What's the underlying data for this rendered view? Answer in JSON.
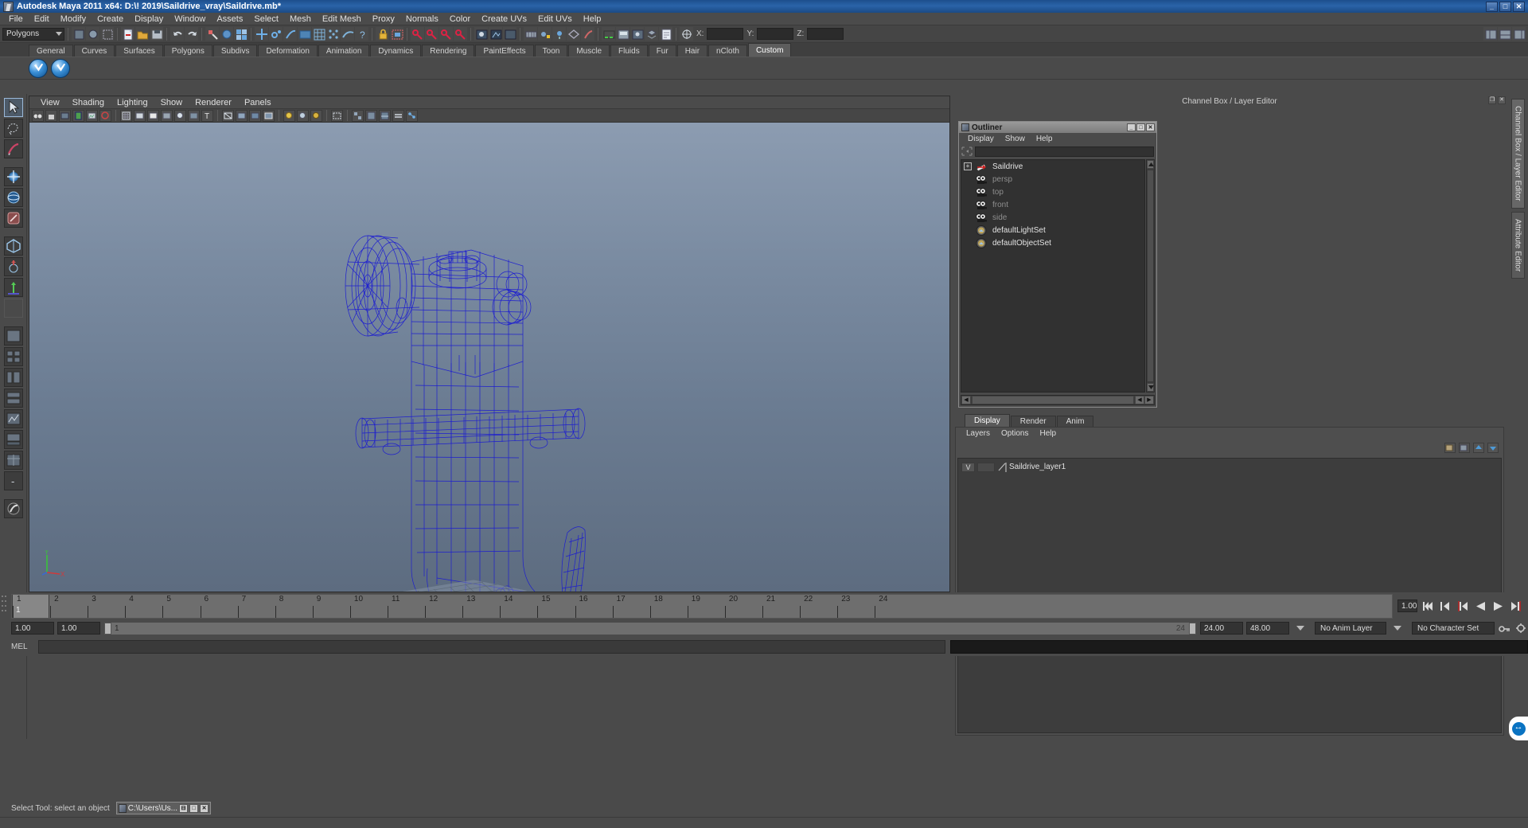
{
  "window": {
    "title": "Autodesk Maya 2011 x64: D:\\! 2019\\Saildrive_vray\\Saildrive.mb*",
    "minimize": "_",
    "maximize": "□",
    "close": "✕"
  },
  "menubar": {
    "items": [
      "File",
      "Edit",
      "Modify",
      "Create",
      "Display",
      "Window",
      "Assets",
      "Select",
      "Mesh",
      "Edit Mesh",
      "Proxy",
      "Normals",
      "Color",
      "Create UVs",
      "Edit UVs",
      "Help"
    ]
  },
  "statusline": {
    "selection_mode": "Polygons",
    "coord_labels": [
      "X:",
      "Y:",
      "Z:"
    ],
    "coord_values": [
      "",
      "",
      ""
    ]
  },
  "shelf": {
    "tabs": [
      "General",
      "Curves",
      "Surfaces",
      "Polygons",
      "Subdivs",
      "Deformation",
      "Animation",
      "Dynamics",
      "Rendering",
      "PaintEffects",
      "Toon",
      "Muscle",
      "Fluids",
      "Fur",
      "Hair",
      "nCloth",
      "Custom"
    ],
    "active_tab": "Custom",
    "buttons": [
      "vray-render-icon",
      "vray-rt-icon"
    ]
  },
  "viewport": {
    "menus": [
      "View",
      "Shading",
      "Lighting",
      "Show",
      "Renderer",
      "Panels"
    ],
    "axis_labels": {
      "y": "Y",
      "x": "X",
      "z": "Z"
    },
    "wireframe_color": "#1a1ad2",
    "background_top": "#8c9cb1",
    "background_bottom": "#5d6c80",
    "model_name": "Saildrive"
  },
  "rightdock": {
    "title": "Channel Box / Layer Editor"
  },
  "outliner": {
    "title": "Outliner",
    "titlebuttons": [
      "_",
      "□",
      "✕"
    ],
    "menus": [
      "Display",
      "Show",
      "Help"
    ],
    "search_value": "",
    "items": [
      {
        "label": "Saildrive",
        "icon": "transform-icon",
        "dim": false,
        "expandable": true
      },
      {
        "label": "persp",
        "icon": "camera-icon",
        "dim": true,
        "expandable": false
      },
      {
        "label": "top",
        "icon": "camera-icon",
        "dim": true,
        "expandable": false
      },
      {
        "label": "front",
        "icon": "camera-icon",
        "dim": true,
        "expandable": false
      },
      {
        "label": "side",
        "icon": "camera-icon",
        "dim": true,
        "expandable": false
      },
      {
        "label": "defaultLightSet",
        "icon": "set-icon",
        "dim": false,
        "expandable": false
      },
      {
        "label": "defaultObjectSet",
        "icon": "set-icon",
        "dim": false,
        "expandable": false
      }
    ]
  },
  "layer_editor": {
    "tabs": [
      "Display",
      "Render",
      "Anim"
    ],
    "active_tab": "Display",
    "menus": [
      "Layers",
      "Options",
      "Help"
    ],
    "layers": [
      {
        "visibility": "V",
        "playback": "",
        "name": "Saildrive_layer1"
      }
    ]
  },
  "vtabs": {
    "items": [
      "Channel Box / Layer Editor",
      "Attribute Editor"
    ],
    "active": "Channel Box / Layer Editor"
  },
  "timeslider": {
    "ticks": [
      1,
      2,
      3,
      4,
      5,
      6,
      7,
      8,
      9,
      10,
      11,
      12,
      13,
      14,
      15,
      16,
      17,
      18,
      19,
      20,
      21,
      22,
      23,
      24
    ],
    "current_frame": "1",
    "current_frame_field": "1.00",
    "playback_buttons": [
      "go-to-start-icon",
      "step-back-keyframe-icon",
      "step-back-frame-icon",
      "play-backwards-icon",
      "play-forwards-icon",
      "step-forward-frame-icon",
      "step-forward-keyframe-icon",
      "go-to-end-icon"
    ]
  },
  "rangeslider": {
    "anim_start": "1.00",
    "range_start": "1.00",
    "bar_start_label": "1",
    "bar_end_label": "24",
    "range_end": "24.00",
    "anim_end": "48.00",
    "anim_layer": "No Anim Layer",
    "character_set": "No Character Set"
  },
  "commandline": {
    "label": "MEL",
    "input_value": "",
    "output_value": ""
  },
  "helpline": {
    "text": "Select Tool: select an object",
    "taskbar_item": "C:\\Users\\Us...",
    "taskbar_buttons": [
      "⊟",
      "□",
      "✕"
    ]
  }
}
